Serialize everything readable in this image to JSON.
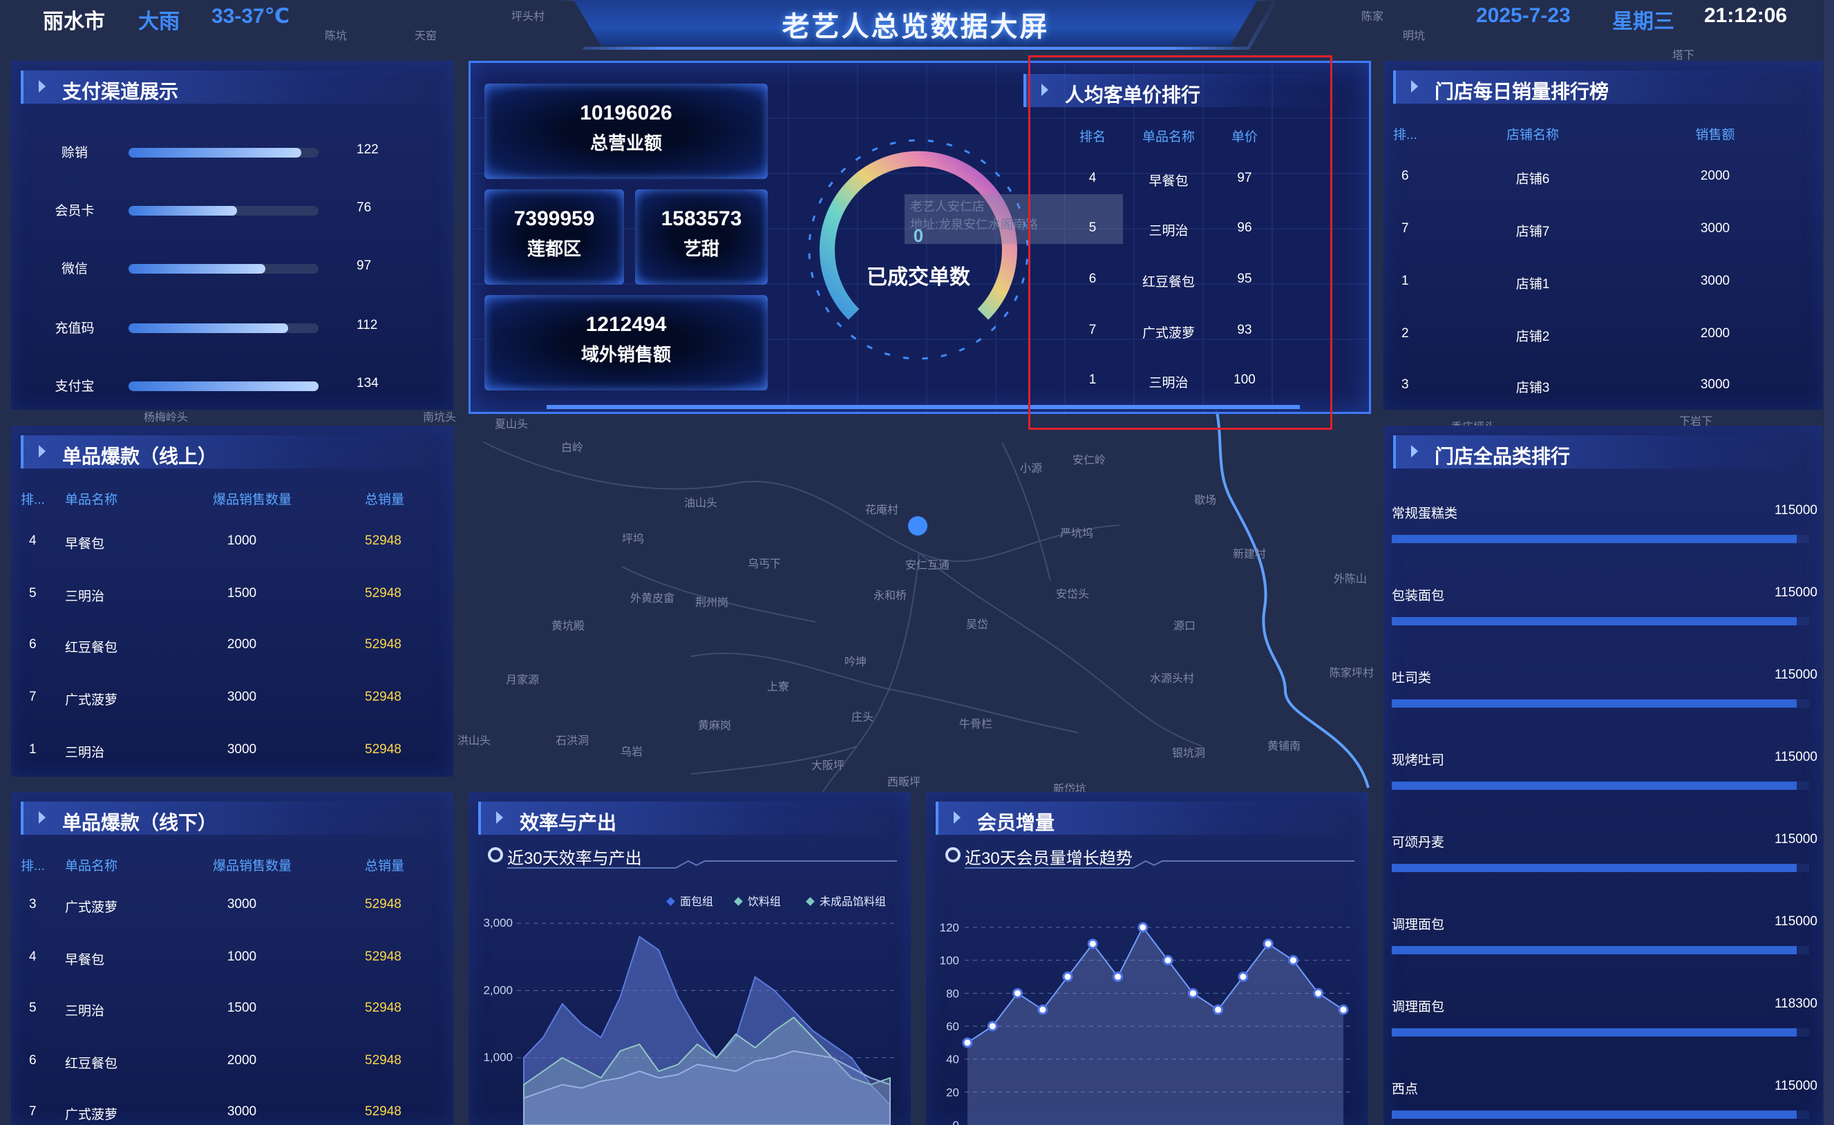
{
  "header": {
    "city": "丽水市",
    "weather": "大雨",
    "temperature": "33-37℃",
    "title": "老艺人总览数据大屏",
    "date": "2025-7-23",
    "weekday": "星期三",
    "time": "21:12:06"
  },
  "payment": {
    "title": "支付渠道展示",
    "items": [
      {
        "label": "赊销",
        "value": "122",
        "fraction": 0.91
      },
      {
        "label": "会员卡",
        "value": "76",
        "fraction": 0.57
      },
      {
        "label": "微信",
        "value": "97",
        "fraction": 0.72
      },
      {
        "label": "充值码",
        "value": "112",
        "fraction": 0.84
      },
      {
        "label": "支付宝",
        "value": "134",
        "fraction": 1.0
      }
    ]
  },
  "kpis": {
    "total": {
      "value": "10196026",
      "label": "总营业额"
    },
    "liandu": {
      "value": "7399959",
      "label": "莲都区"
    },
    "yitian": {
      "value": "1583573",
      "label": "艺甜"
    },
    "overseas": {
      "value": "1212494",
      "label": "域外销售额"
    },
    "gauge": {
      "value": "0",
      "label": "已成交单数"
    },
    "tooltip": [
      "老艺人安仁店",
      "地址:龙泉安仁水阁南路"
    ]
  },
  "unit_price": {
    "title": "人均客单价排行",
    "headers": [
      "排名",
      "单品名称",
      "单价"
    ],
    "rows": [
      [
        "4",
        "早餐包",
        "97"
      ],
      [
        "5",
        "三明治",
        "96"
      ],
      [
        "6",
        "红豆餐包",
        "95"
      ],
      [
        "7",
        "广式菠萝",
        "93"
      ],
      [
        "1",
        "三明治",
        "100"
      ]
    ]
  },
  "store_sales": {
    "title": "门店每日销量排行榜",
    "headers": [
      "排...",
      "店铺名称",
      "销售额"
    ],
    "rows": [
      [
        "6",
        "店铺6",
        "2000"
      ],
      [
        "7",
        "店铺7",
        "3000"
      ],
      [
        "1",
        "店铺1",
        "3000"
      ],
      [
        "2",
        "店铺2",
        "2000"
      ],
      [
        "3",
        "店铺3",
        "3000"
      ]
    ]
  },
  "online": {
    "title": "单品爆款（线上）",
    "headers": [
      "排...",
      "单品名称",
      "爆品销售数量",
      "总销量"
    ],
    "rows": [
      [
        "4",
        "早餐包",
        "1000",
        "52948"
      ],
      [
        "5",
        "三明治",
        "1500",
        "52948"
      ],
      [
        "6",
        "红豆餐包",
        "2000",
        "52948"
      ],
      [
        "7",
        "广式菠萝",
        "3000",
        "52948"
      ],
      [
        "1",
        "三明治",
        "3000",
        "52948"
      ]
    ]
  },
  "offline": {
    "title": "单品爆款（线下）",
    "headers": [
      "排...",
      "单品名称",
      "爆品销售数量",
      "总销量"
    ],
    "rows": [
      [
        "3",
        "广式菠萝",
        "3000",
        "52948"
      ],
      [
        "4",
        "早餐包",
        "1000",
        "52948"
      ],
      [
        "5",
        "三明治",
        "1500",
        "52948"
      ],
      [
        "6",
        "红豆餐包",
        "2000",
        "52948"
      ],
      [
        "7",
        "广式菠萝",
        "3000",
        "52948"
      ]
    ]
  },
  "category": {
    "title": "门店全品类排行",
    "items": [
      {
        "name": "常规蛋糕类",
        "value": "115000",
        "fraction": 0.97
      },
      {
        "name": "包装面包",
        "value": "115000",
        "fraction": 0.97
      },
      {
        "name": "吐司类",
        "value": "115000",
        "fraction": 0.97
      },
      {
        "name": "现烤吐司",
        "value": "115000",
        "fraction": 0.97
      },
      {
        "name": "可颂丹麦",
        "value": "115000",
        "fraction": 0.97
      },
      {
        "name": "调理面包",
        "value": "115000",
        "fraction": 0.97
      },
      {
        "name": "调理面包",
        "value": "118300",
        "fraction": 0.97
      },
      {
        "name": "西点",
        "value": "115000",
        "fraction": 0.97
      }
    ]
  },
  "efficiency": {
    "title": "效率与产出",
    "subtitle": "近30天效率与产出"
  },
  "members": {
    "title": "会员增量",
    "subtitle": "近30天会员量增长趋势"
  },
  "map_labels": [
    "坪头村",
    "陈坑",
    "天窑",
    "陈家",
    "明坑",
    "塔下",
    "夏山头",
    "白岭",
    "油山头",
    "花庵村",
    "小源",
    "安仁岭",
    "歇场",
    "坪坞",
    "乌丐下",
    "外黄皮畲",
    "荆州岗",
    "严坑坞",
    "新建村",
    "外陈山",
    "安仁互通",
    "永和桥",
    "吴岱",
    "安岱头",
    "源口",
    "黄坑殿",
    "月家源",
    "上寮",
    "吟坤",
    "水源头村",
    "陈家坪村",
    "洪山头",
    "石洪洞",
    "乌岩",
    "黄麻岗",
    "庄头",
    "牛骨栏",
    "大阪坪",
    "银坑洞",
    "黄铺南",
    "西畈坪",
    "新岱坑",
    "杨梅岭头",
    "南坑头",
    "下岩下",
    "香庄坪头"
  ],
  "colors": {
    "accent": "#4f8cff",
    "yellow_value": "#ffd84a",
    "highlight_box": "#e0202a"
  },
  "chart_data": [
    {
      "type": "area",
      "subtitle": "近30天效率与产出",
      "ylim": [
        0,
        3000
      ],
      "y_ticks": [
        "1,000",
        "2,000",
        "3,000"
      ],
      "legend": [
        "面包组",
        "饮料组",
        "未成品馅料组"
      ],
      "series": [
        {
          "name": "面包组",
          "values": [
            1000,
            1300,
            1800,
            1500,
            1300,
            1900,
            2800,
            2600,
            1900,
            1400,
            1000,
            1300,
            2200,
            2000,
            1700,
            1400,
            1200,
            1000,
            600,
            300
          ]
        },
        {
          "name": "饮料组",
          "values": [
            600,
            800,
            1000,
            850,
            700,
            1100,
            1200,
            800,
            900,
            1200,
            1000,
            1350,
            1150,
            1400,
            1600,
            1300,
            1000,
            700,
            600,
            700
          ]
        },
        {
          "name": "未成品馅料组",
          "values": [
            400,
            500,
            600,
            550,
            650,
            700,
            800,
            700,
            750,
            900,
            850,
            800,
            950,
            1000,
            1100,
            1050,
            1000,
            850,
            700,
            600
          ]
        }
      ]
    },
    {
      "type": "line",
      "subtitle": "近30天会员量增长趋势",
      "ylim": [
        0,
        120
      ],
      "y_ticks": [
        "0",
        "20",
        "40",
        "60",
        "80",
        "100",
        "120"
      ],
      "series": [
        {
          "name": "",
          "values": [
            50,
            60,
            80,
            70,
            90,
            110,
            90,
            120,
            100,
            80,
            70,
            90,
            110,
            100,
            80,
            70
          ]
        }
      ]
    }
  ]
}
